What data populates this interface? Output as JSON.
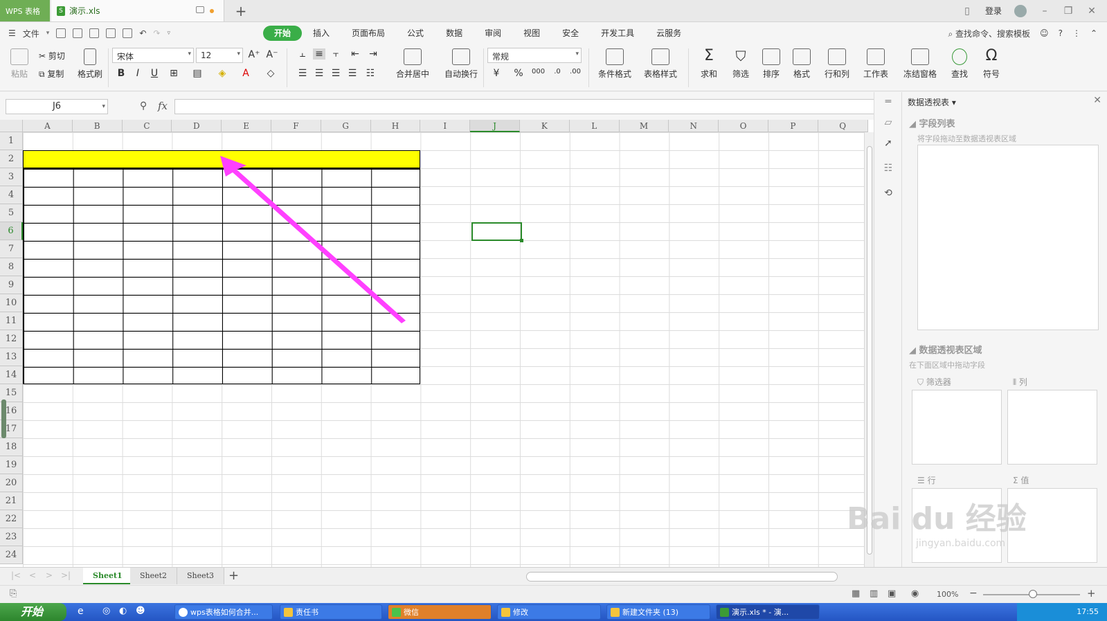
{
  "titlebar": {
    "app_tab": "WPS 表格",
    "doc_tab": "演示.xls",
    "login": "登录"
  },
  "menu": {
    "file": "文件",
    "tabs": [
      "开始",
      "插入",
      "页面布局",
      "公式",
      "数据",
      "审阅",
      "视图",
      "安全",
      "开发工具",
      "云服务"
    ],
    "active_tab": "开始",
    "search": "查找命令、搜索模板"
  },
  "ribbon": {
    "paste": "粘贴",
    "cut": "剪切",
    "copy": "复制",
    "format_painter": "格式刷",
    "font_name": "宋体",
    "font_size": "12",
    "merge_center": "合并居中",
    "wrap_text": "自动换行",
    "number_format": "常规",
    "conditional_format": "条件格式",
    "table_style": "表格样式",
    "sum": "求和",
    "filter": "筛选",
    "sort": "排序",
    "format": "格式",
    "rows_cols": "行和列",
    "worksheet": "工作表",
    "freeze": "冻结窗格",
    "find": "查找",
    "symbol": "符号"
  },
  "formula_bar": {
    "name_box": "J6",
    "fx": "fx",
    "value": ""
  },
  "grid": {
    "columns": [
      "A",
      "B",
      "C",
      "D",
      "E",
      "F",
      "G",
      "H",
      "I",
      "J",
      "K",
      "L",
      "M",
      "N",
      "O",
      "P",
      "Q"
    ],
    "rows": [
      "1",
      "2",
      "3",
      "4",
      "5",
      "6",
      "7",
      "8",
      "9",
      "10",
      "11",
      "12",
      "13",
      "14",
      "15",
      "16",
      "17",
      "18",
      "19",
      "20",
      "21",
      "22",
      "23",
      "24"
    ],
    "active_cell": "J6",
    "highlight_color": "#ffff00",
    "arrow_color": "#ff40ff"
  },
  "pivot": {
    "title": "数据透视表",
    "field_list": "字段列表",
    "field_hint": "将字段拖动至数据透视表区域",
    "area_title": "数据透视表区域",
    "area_hint": "在下面区域中拖动字段",
    "filter": "筛选器",
    "columns": "列",
    "rows": "行",
    "values": "值"
  },
  "sheets": {
    "tabs": [
      "Sheet1",
      "Sheet2",
      "Sheet3"
    ],
    "active": "Sheet1"
  },
  "status": {
    "zoom": "100%"
  },
  "taskbar": {
    "start": "开始",
    "items": [
      "wps表格如何合并...",
      "责任书",
      "微信",
      "修改",
      "新建文件夹 (13)",
      "演示.xls * - 演..."
    ],
    "clock": "17:55"
  },
  "watermark": {
    "brand": "Bai du 经验",
    "url": "jingyan.baidu.com"
  }
}
